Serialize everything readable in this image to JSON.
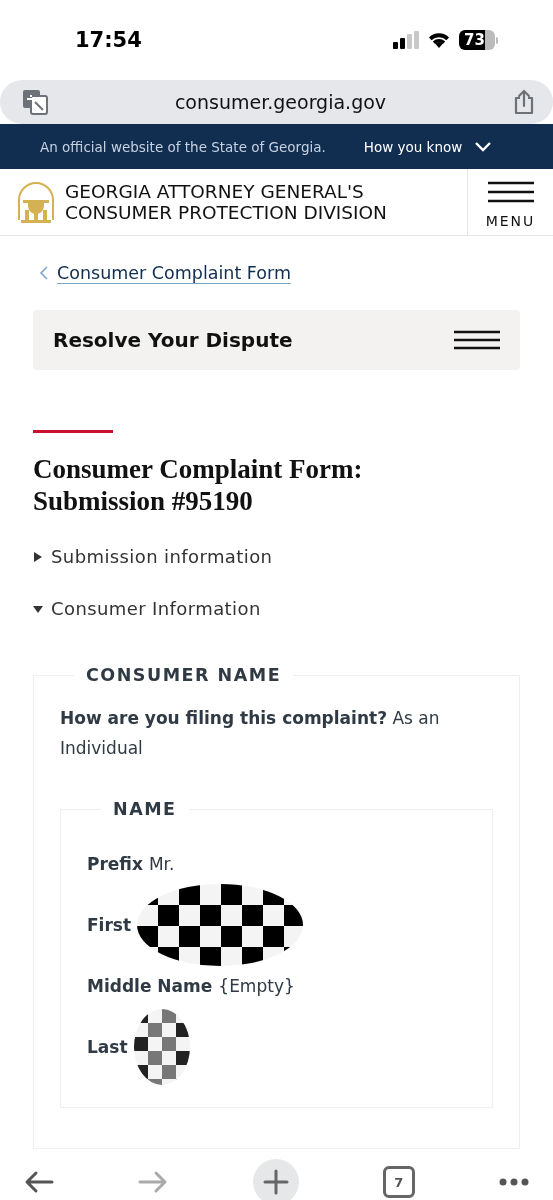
{
  "status_bar": {
    "time": "17:54",
    "battery": "73"
  },
  "address_bar": {
    "url": "consumer.georgia.gov"
  },
  "gov_banner": {
    "text": "An official website of the State of Georgia.",
    "link": "How you know",
    "expanded": false
  },
  "site_header": {
    "title_lines": [
      "GEORGIA ATTORNEY GENERAL'S",
      "CONSUMER PROTECTION DIVISION"
    ],
    "menu_label": "MENU"
  },
  "breadcrumb": {
    "label": "Consumer Complaint Form"
  },
  "section_nav": {
    "title": "Resolve Your Dispute"
  },
  "page_title": "Consumer Complaint Form: Submission #95190",
  "sections": [
    {
      "label": "Submission information",
      "expanded": false
    },
    {
      "label": "Consumer Information",
      "expanded": true
    }
  ],
  "fieldset": {
    "legend": "CONSUMER NAME",
    "question": "**How are you filing this complaint?** As an Individual",
    "inner": {
      "legend": "NAME",
      "fields": [
        {
          "label": "Prefix",
          "value": "Mr.",
          "redacted": false
        },
        {
          "label": "First",
          "redacted": true
        },
        {
          "label": "Middle Name",
          "value": "{Empty}",
          "redacted": false
        },
        {
          "label": "Last",
          "redacted": true
        }
      ]
    }
  },
  "toolbar": {
    "tab_count": "7"
  }
}
